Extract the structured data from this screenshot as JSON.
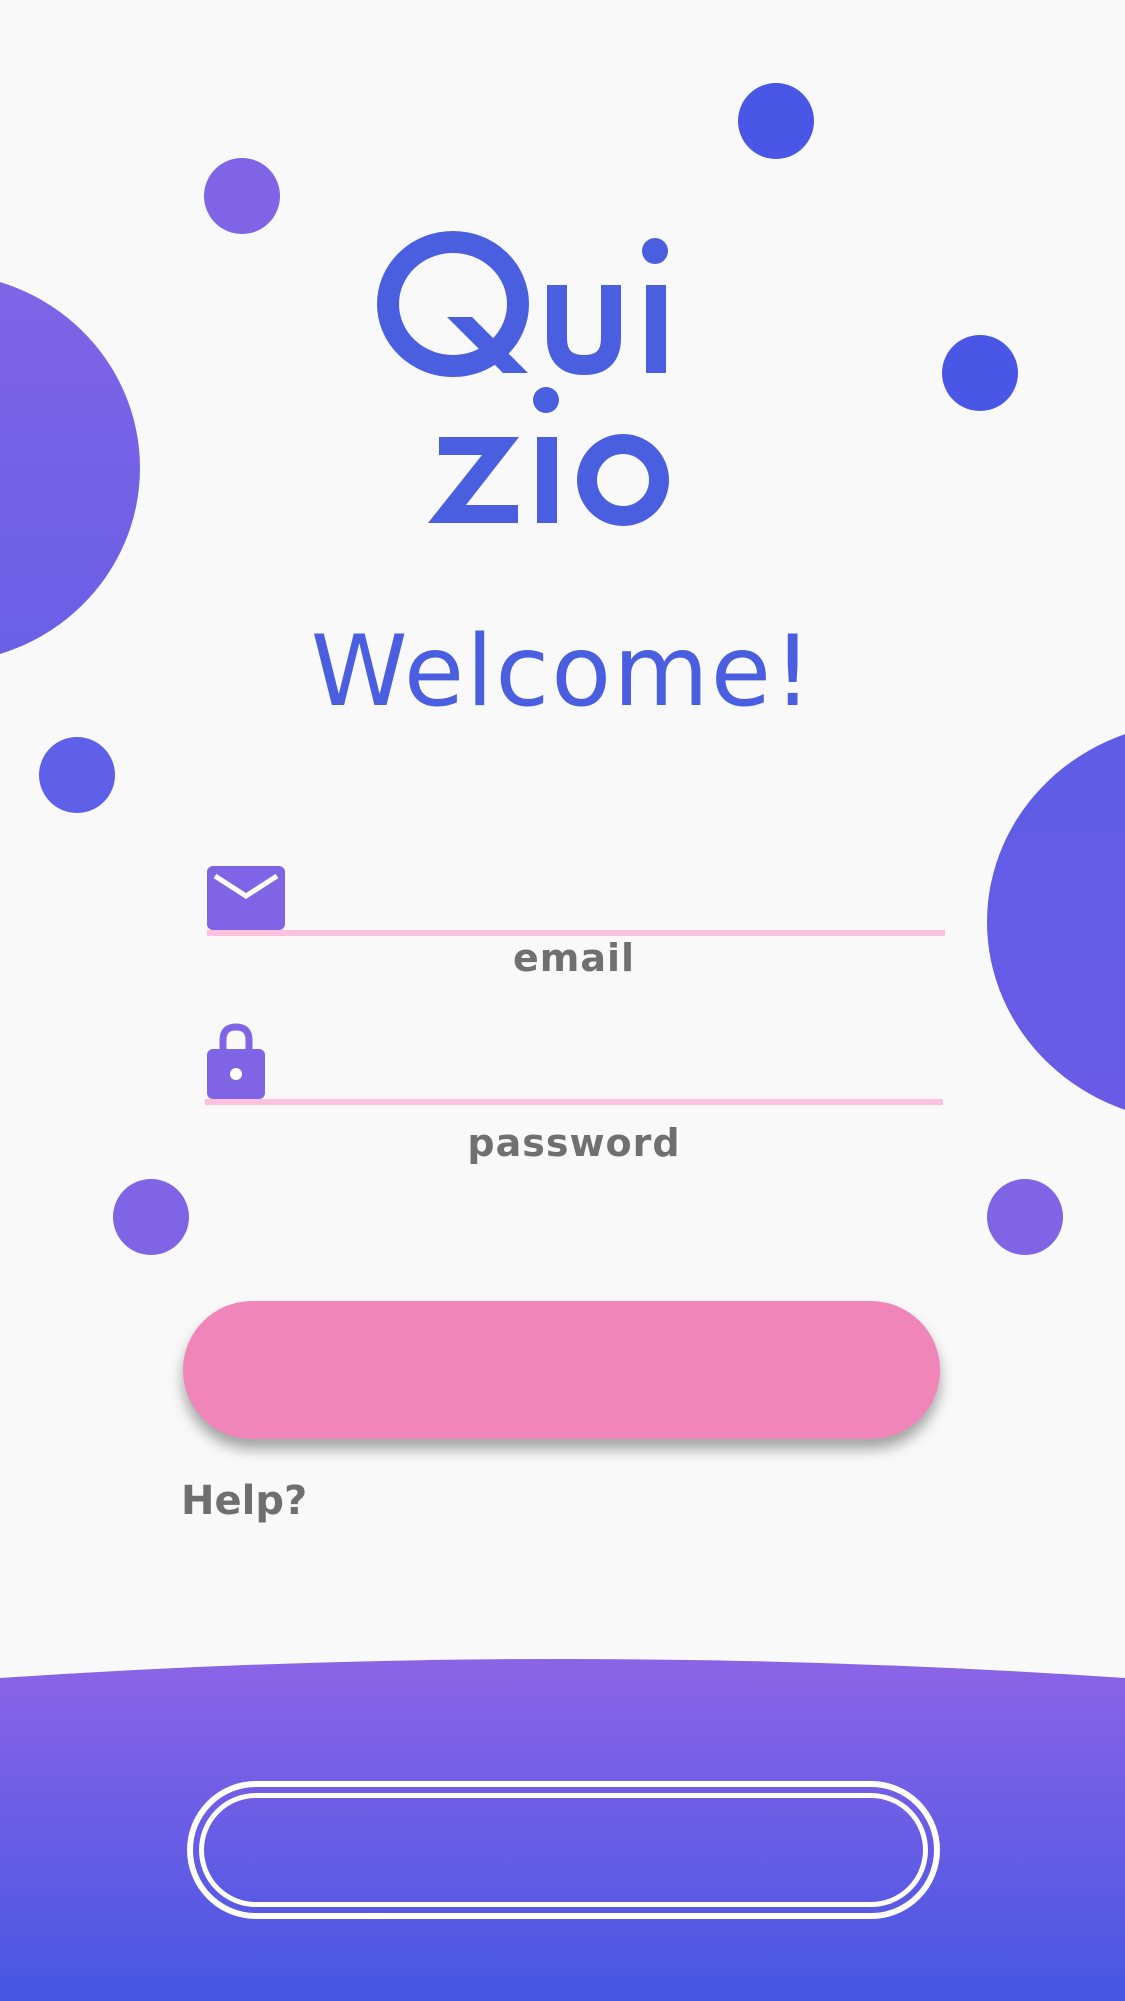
{
  "app": {
    "logo_line1": "Qui",
    "logo_line2": "ZIO"
  },
  "welcome": {
    "text": "Welcome!"
  },
  "form": {
    "email": {
      "label": "email",
      "icon": "envelope-icon",
      "value": ""
    },
    "password": {
      "label": "password",
      "icon": "lock-icon",
      "value": ""
    }
  },
  "actions": {
    "login_label": "",
    "help_label": "Help?",
    "signup_label": ""
  },
  "colors": {
    "brand_blue": "#4a5fe0",
    "accent_purple": "#7f64e6",
    "button_pink": "#ef85b8",
    "field_underline": "#fbc1dd",
    "label_gray": "#707070"
  }
}
